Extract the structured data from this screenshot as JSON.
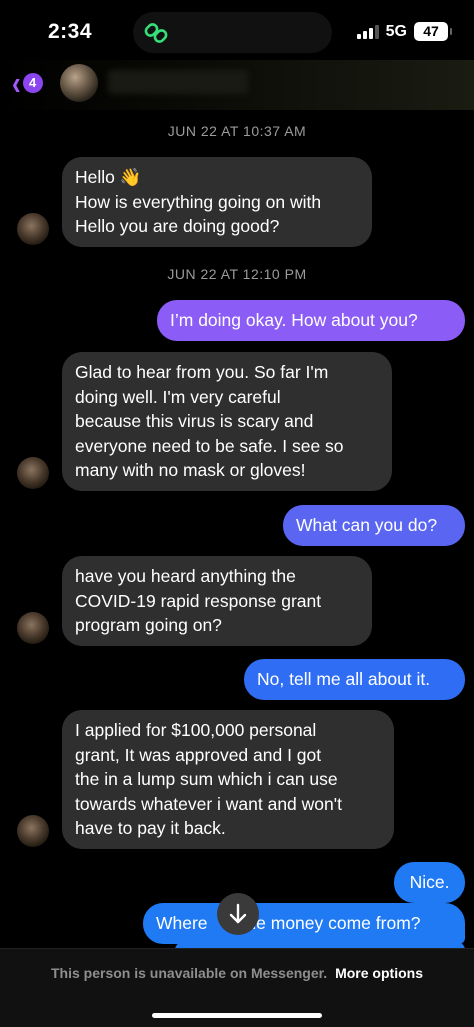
{
  "status_bar": {
    "time": "2:34",
    "network": "5G",
    "battery": "47"
  },
  "header": {
    "back_badge_count": "4",
    "icons": [
      "chevron-left-icon",
      "link-icon"
    ]
  },
  "colors": {
    "accent": "#8b46f0",
    "incoming_bubble": "#2f2f2f",
    "out_top": "#8b5cf6",
    "out_bottom": "#1f7af4"
  },
  "messages": {
    "ts1": "JUN 22 AT 10:37 AM",
    "m1": [
      "Hello 👋",
      "How is everything going on with",
      "Hello you are doing good?"
    ],
    "ts2": "JUN 22 AT 12:10 PM",
    "m2": [
      "I’m doing okay.  How about you?"
    ],
    "m3": [
      "Glad to hear from you. So far I'm",
      "doing well. I'm very careful",
      "because this virus is scary and",
      "everyone  need to be safe. I see so",
      "many with no mask or gloves!"
    ],
    "m4": [
      "What can you do?"
    ],
    "m5": [
      "have you  heard anything the",
      "COVID-19  rapid response grant",
      "program going on?"
    ],
    "m6": [
      "No, tell me all about it."
    ],
    "m7": [
      "I applied for $100,000 personal",
      "grant, It was approved and I got",
      "the in a lump sum which i can use",
      "towards whatever i want and won't",
      "have to pay it back."
    ],
    "m8": [
      "Nice."
    ],
    "m9a": "Where",
    "m9b": "the money come from?"
  },
  "footer": {
    "notice": "This person is unavailable on Messenger.",
    "more_options": "More options"
  }
}
